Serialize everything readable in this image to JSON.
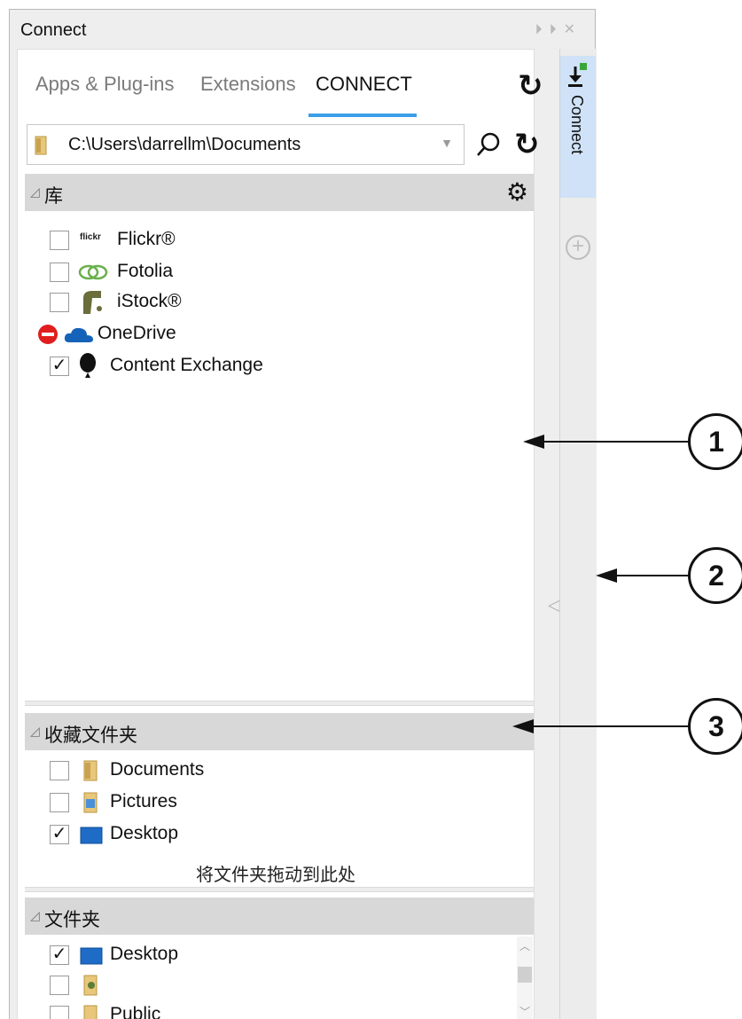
{
  "panel": {
    "title": "Connect",
    "tabs": [
      {
        "label": "Apps & Plug-ins"
      },
      {
        "label": "Extensions"
      },
      {
        "label": "CONNECT"
      }
    ],
    "path": "C:\\Users\\darrellm\\Documents",
    "accent_color": "#3b9ee8"
  },
  "libraries": {
    "header": "库",
    "items": [
      {
        "label": "Flickr®",
        "logo_text": "flickr",
        "checked": false
      },
      {
        "label": "Fotolia",
        "checked": false
      },
      {
        "label": "iStock®",
        "checked": false
      },
      {
        "label": "OneDrive",
        "status": "blocked"
      },
      {
        "label": "Content Exchange",
        "checked": true
      }
    ]
  },
  "favorites": {
    "header": "收藏文件夹",
    "items": [
      {
        "label": "Documents",
        "checked": false
      },
      {
        "label": "Pictures",
        "checked": false
      },
      {
        "label": "Desktop",
        "checked": true
      }
    ],
    "drop_hint": "将文件夹拖动到此处"
  },
  "folders": {
    "header": "文件夹",
    "items": [
      {
        "label": "Desktop",
        "checked": true
      },
      {
        "label": "",
        "checked": false
      },
      {
        "label": "Public",
        "checked": false
      }
    ]
  },
  "side_tab": {
    "label": "Connect"
  },
  "callouts": [
    "1",
    "2",
    "3"
  ]
}
